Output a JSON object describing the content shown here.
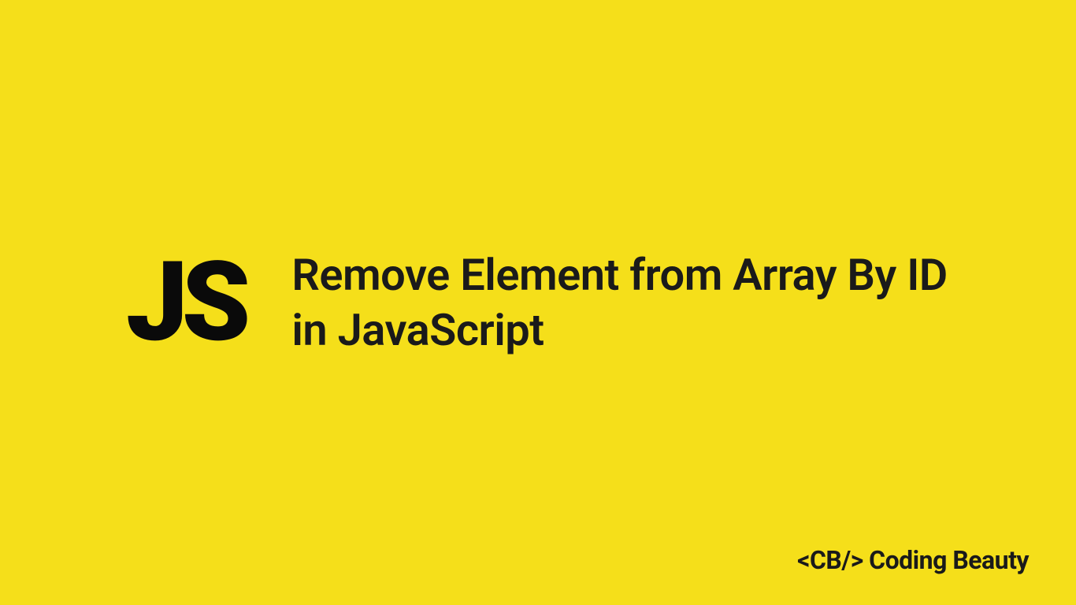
{
  "logo": {
    "text": "JS"
  },
  "heading": {
    "text": "Remove Element from Array By ID in JavaScript"
  },
  "brand": {
    "text": "<CB/> Coding Beauty"
  }
}
